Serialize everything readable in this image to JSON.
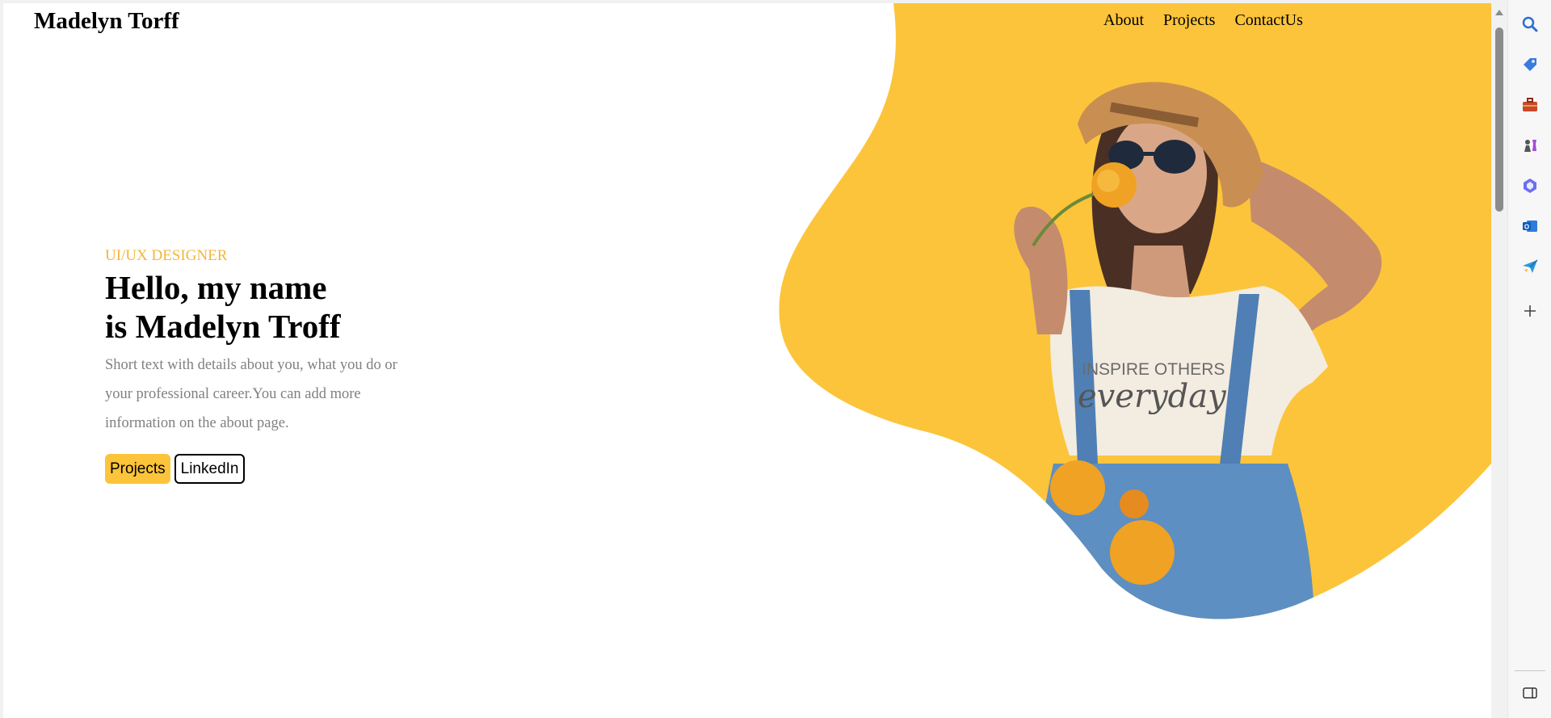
{
  "site": {
    "name": "Madelyn Torff"
  },
  "nav": {
    "items": [
      "About",
      "Projects",
      "ContactUs"
    ]
  },
  "hero": {
    "role": "UI/UX DESIGNER",
    "headline_line1": "Hello, my name",
    "headline_line2": "is Madelyn Troff",
    "description": "Short text with details about you, what you do or your professional career.You can add more information on the about page.",
    "primary_button": "Projects",
    "secondary_button": "LinkedIn"
  },
  "colors": {
    "accent": "#fcc43a",
    "role_text": "#f3b63a",
    "description_text": "#808080"
  },
  "browser_sidebar": {
    "icons": [
      "search-icon",
      "tag-icon",
      "briefcase-icon",
      "chess-icon",
      "copilot-icon",
      "outlook-icon",
      "send-icon",
      "add-icon",
      "panel-toggle-icon"
    ]
  }
}
